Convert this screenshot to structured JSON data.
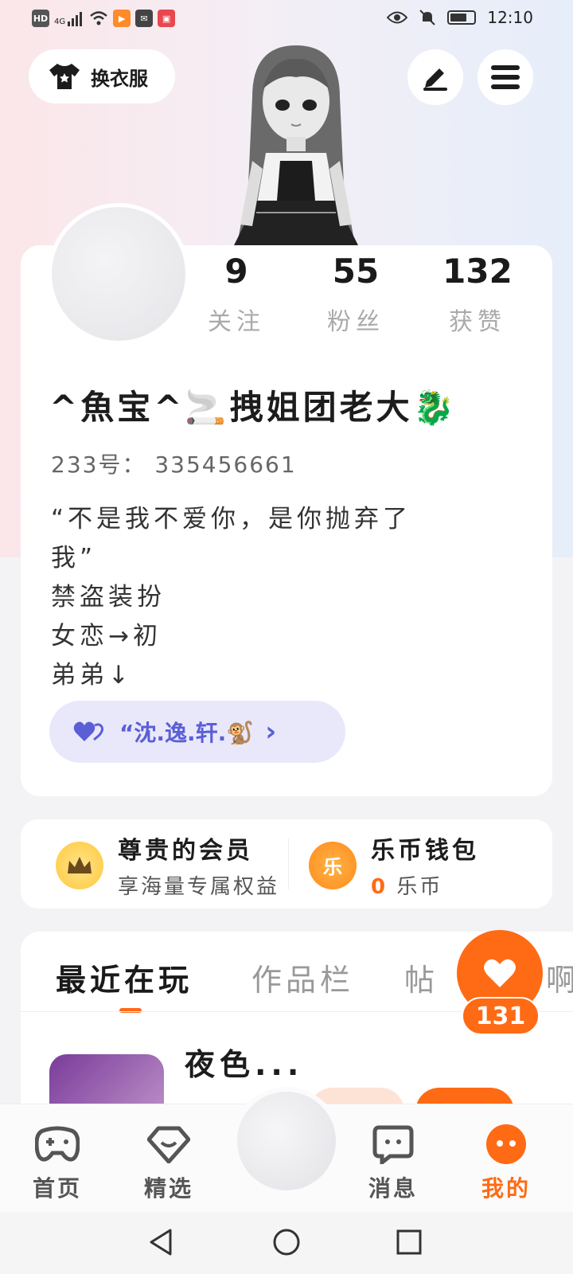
{
  "status_bar": {
    "left_icons": [
      "HD",
      "4G",
      "signal-icon",
      "wifi-icon",
      "video-app-icon",
      "mail-app-icon",
      "calendar-app-icon"
    ],
    "right_icons": [
      "eye-icon",
      "mute-icon",
      "battery-icon"
    ],
    "time": "12:10"
  },
  "header": {
    "outfit_label": "换衣服",
    "edit_icon": "pen-icon",
    "menu_icon": "menu-icon"
  },
  "stats": [
    {
      "value": "9",
      "label": "关注"
    },
    {
      "value": "55",
      "label": "粉丝"
    },
    {
      "value": "132",
      "label": "获赞"
    }
  ],
  "profile": {
    "username": "^魚宝^🚬拽姐团老大🐉",
    "uid": "233号： 335456661",
    "bio": "“不是我不爱你，是你抛弃了\n我”\n禁盗装扮\n女恋→初\n弟弟↓",
    "relation_name": "“沈.逸.轩.🐒",
    "relation_chevron": "›"
  },
  "vip": {
    "member_title": "尊贵的会员",
    "member_sub": "享海量专属权益",
    "wallet_title": "乐币钱包",
    "wallet_amount": "0",
    "wallet_unit": "乐币",
    "coin_char": "乐"
  },
  "tabs": [
    "最近在玩",
    "作品栏",
    "帖",
    "啊"
  ],
  "recent_game": {
    "title": "夜色..."
  },
  "like_fab": {
    "count": "131"
  },
  "bottom_nav": [
    {
      "label": "首页"
    },
    {
      "label": "精选"
    },
    {
      "label": "消息"
    },
    {
      "label": "我的"
    }
  ],
  "colors": {
    "accent": "#ff6a14",
    "relation_bg": "#e9e8fb",
    "relation_text": "#5a5fd6"
  }
}
